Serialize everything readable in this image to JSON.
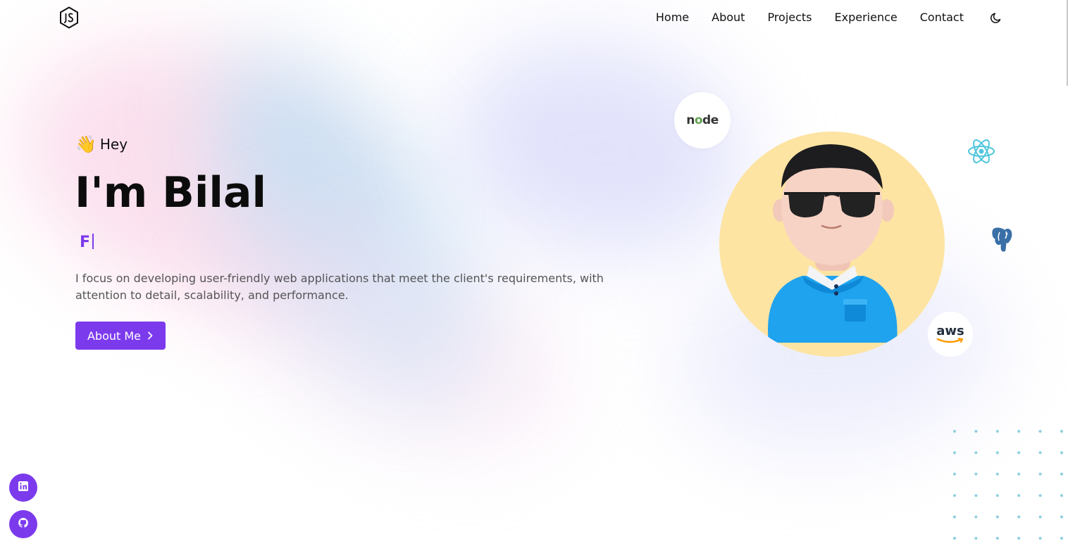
{
  "logo": {
    "icon": "js-hexagon-logo-icon"
  },
  "nav": {
    "items": [
      {
        "label": "Home"
      },
      {
        "label": "About"
      },
      {
        "label": "Projects"
      },
      {
        "label": "Experience"
      },
      {
        "label": "Contact"
      }
    ],
    "theme_toggle_icon": "moon-icon"
  },
  "hero": {
    "wave_emoji": "👋",
    "greeting": "Hey",
    "title": "I'm Bilal",
    "typed_text": "F",
    "description": "I focus on developing user-friendly web applications that meet the client's requirements, with attention to detail, scalability, and performance.",
    "button_label": "About Me",
    "button_icon": "chevron-right-icon"
  },
  "tech_badges": {
    "node": "node",
    "aws": "aws",
    "react_icon": "react-icon",
    "postgres_icon": "postgresql-icon"
  },
  "social": [
    {
      "icon": "linkedin-icon"
    },
    {
      "icon": "github-icon"
    }
  ],
  "colors": {
    "accent": "#7c3aed",
    "avatar_bg": "#fde4a2",
    "dots": "#8ecfe0"
  }
}
